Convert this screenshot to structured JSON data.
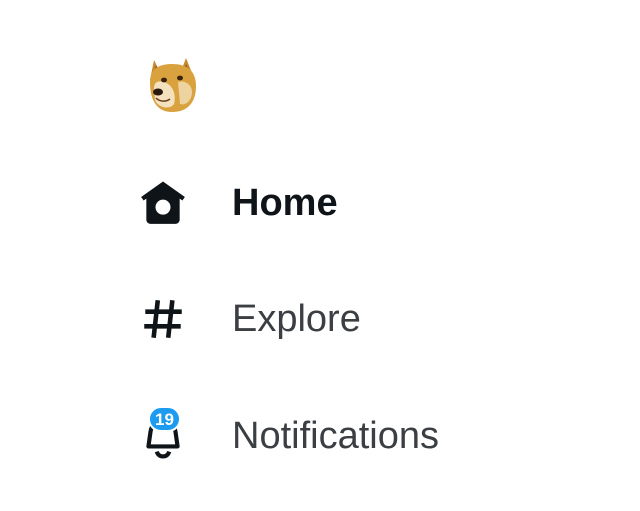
{
  "logo": {
    "icon": "doge-avatar-icon"
  },
  "nav": {
    "items": [
      {
        "id": "home",
        "label": "Home",
        "icon": "home-icon",
        "active": true
      },
      {
        "id": "explore",
        "label": "Explore",
        "icon": "hashtag-icon",
        "active": false
      },
      {
        "id": "notifications",
        "label": "Notifications",
        "icon": "bell-icon",
        "active": false,
        "badge": "19"
      }
    ]
  },
  "colors": {
    "badge": "#1d9bf0",
    "active_text": "#0f1419",
    "inactive_text": "#3b3f43"
  }
}
